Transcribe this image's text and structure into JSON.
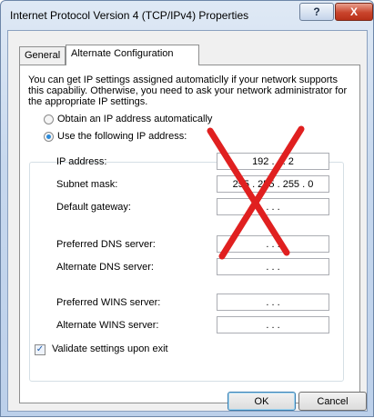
{
  "window": {
    "title": "Internet Protocol Version 4 (TCP/IPv4) Properties",
    "help_label": "?",
    "close_label": "X"
  },
  "tabs": [
    "General",
    "Alternate Configuration"
  ],
  "description": "You can get IP settings assigned automaticlly if your network supports this capabiliy. Otherwise, you need to ask your network administrator for the appropriate IP settings.",
  "options": {
    "auto": "Obtain an IP address automatically",
    "manual": "Use the following IP address:",
    "selected": "manual"
  },
  "fields": [
    {
      "label": "IP address:",
      "value": "192 .         .        . 2"
    },
    {
      "label": "Subnet mask:",
      "value": "255 . 255 . 255 . 0"
    },
    {
      "label": "Default gateway:",
      "value": ".         .         ."
    },
    {
      "label": "Preferred DNS server:",
      "value": ".         .         ."
    },
    {
      "label": "Alternate DNS server:",
      "value": ".         .         ."
    },
    {
      "label": "Preferred WINS server:",
      "value": ".         .         ."
    },
    {
      "label": "Alternate WINS server:",
      "value": ".         .         ."
    }
  ],
  "validate": {
    "label": "Validate settings upon exit",
    "checked": true,
    "mark": "✓"
  },
  "buttons": {
    "ok": "OK",
    "cancel": "Cancel"
  },
  "overlay": {
    "icon": "red-cross-mark",
    "color": "#e02020"
  }
}
